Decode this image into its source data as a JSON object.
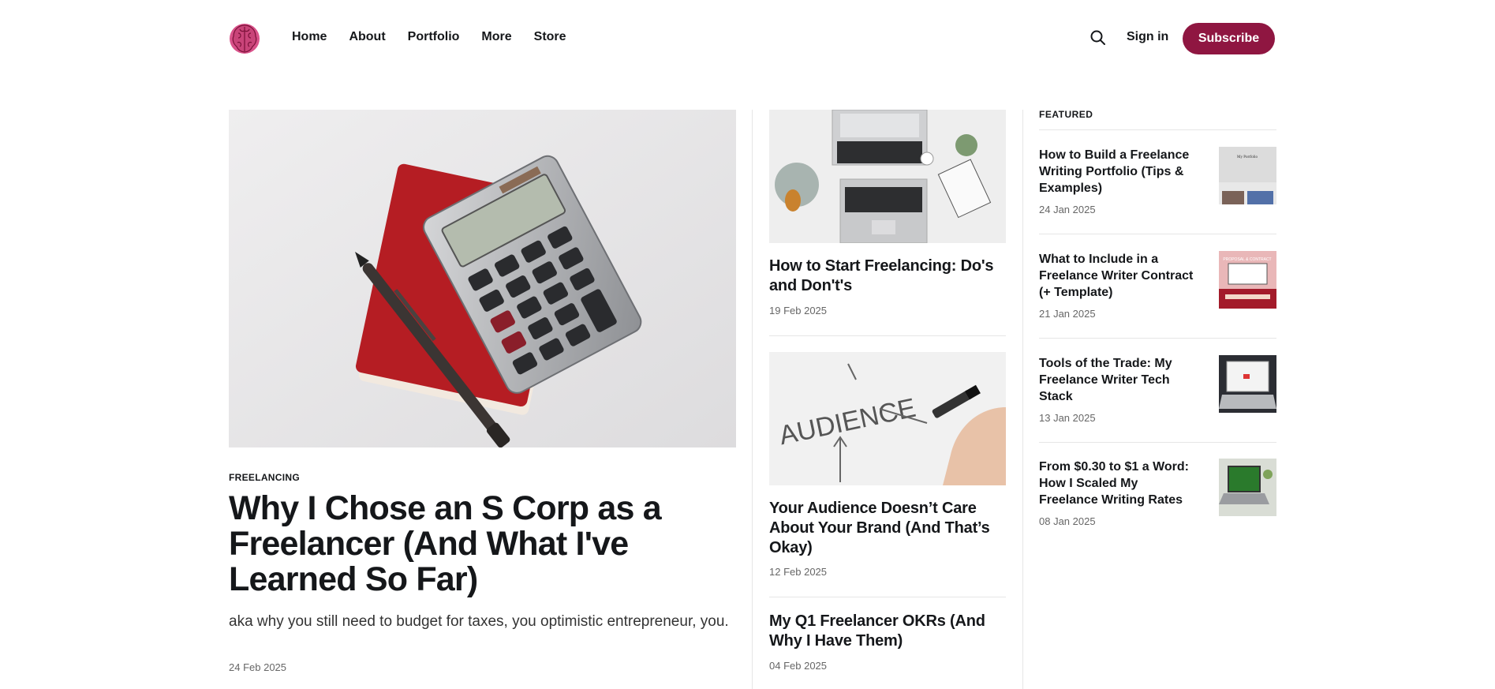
{
  "nav": {
    "items": [
      "Home",
      "About",
      "Portfolio",
      "More",
      "Store"
    ],
    "signin": "Sign in",
    "subscribe": "Subscribe",
    "search_icon": "search-icon",
    "logo_icon": "brain-logo-icon"
  },
  "colors": {
    "accent": "#8f1641",
    "logo": "#d9528a"
  },
  "hero": {
    "tag": "FREELANCING",
    "title": "Why I Chose an S Corp as a Freelancer (And What I've Learned So Far)",
    "excerpt": "aka why you still need to budget for taxes, you optimistic entrepreneur, you.",
    "date": "24 Feb 2025"
  },
  "middle": [
    {
      "title": "How to Start Freelancing: Do's and Don't's",
      "date": "19 Feb 2025"
    },
    {
      "title": "Your Audience Doesn’t Care About Your Brand (And That’s Okay)",
      "date": "12 Feb 2025"
    },
    {
      "title": "My Q1 Freelancer OKRs (And Why I Have Them)",
      "date": "04 Feb 2025"
    }
  ],
  "featured": {
    "label": "FEATURED",
    "items": [
      {
        "title": "How to Build a Freelance Writing Portfolio (Tips & Examples)",
        "date": "24 Jan 2025",
        "thumb_text": "My Portfolio"
      },
      {
        "title": "What to Include in a Freelance Writer Contract (+ Template)",
        "date": "21 Jan 2025",
        "thumb_text": "PROPOSAL & CONTRACT"
      },
      {
        "title": "Tools of the Trade: My Freelance Writer Tech Stack",
        "date": "13 Jan 2025"
      },
      {
        "title": "From $0.30 to $1 a Word: How I Scaled My Freelance Writing Rates",
        "date": "08 Jan 2025"
      }
    ]
  }
}
